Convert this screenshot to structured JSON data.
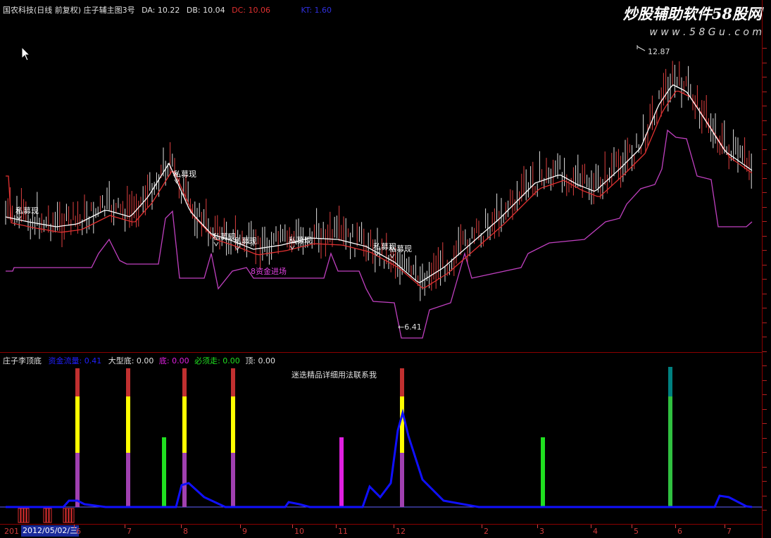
{
  "header": {
    "title": "国农科技(日线 前复权) 庄子辅主图3号",
    "da_label": "DA: 10.22",
    "db_label": "DB: 10.04",
    "dc_label": "DC: 10.06",
    "extra_label": "KT: 1.60"
  },
  "watermark": {
    "brand": "炒股辅助软件58股网",
    "url": "w w w . 5 8 G u . c o m"
  },
  "main_chart": {
    "high_label": "12.87",
    "low_label": "←6.41",
    "annotations": [
      "私募现",
      "私募现",
      "私募现",
      "私募现",
      "私募现",
      "私募现",
      "私募现"
    ],
    "fund_label": "8资金进场"
  },
  "sub_panel": {
    "indicator_name": "庄子李顶底",
    "blue_label": "资金流量: 0.41",
    "big_bottom": "大型底: 0.00",
    "bottom": "底: 0.00",
    "must_go": "必须走: 0.00",
    "top": "顶: 0.00",
    "notice": "迷迭精品详细用法联系我"
  },
  "xaxis": {
    "date_badge": "2012/05/02/三",
    "year_prefix": "201",
    "months": [
      "6",
      "7",
      "8",
      "9",
      "10",
      "11",
      "12",
      "2",
      "3",
      "4",
      "5",
      "6",
      "7"
    ]
  },
  "colors": {
    "red_line": "#e03030",
    "white_line": "#ffffff",
    "purple_line": "#c040c0",
    "blue_curve": "#1010ff",
    "yellow_bar": "#ffff00",
    "green_bar": "#20e020",
    "magenta_bar": "#e020e0",
    "teal_bar": "#00a0a0"
  }
}
